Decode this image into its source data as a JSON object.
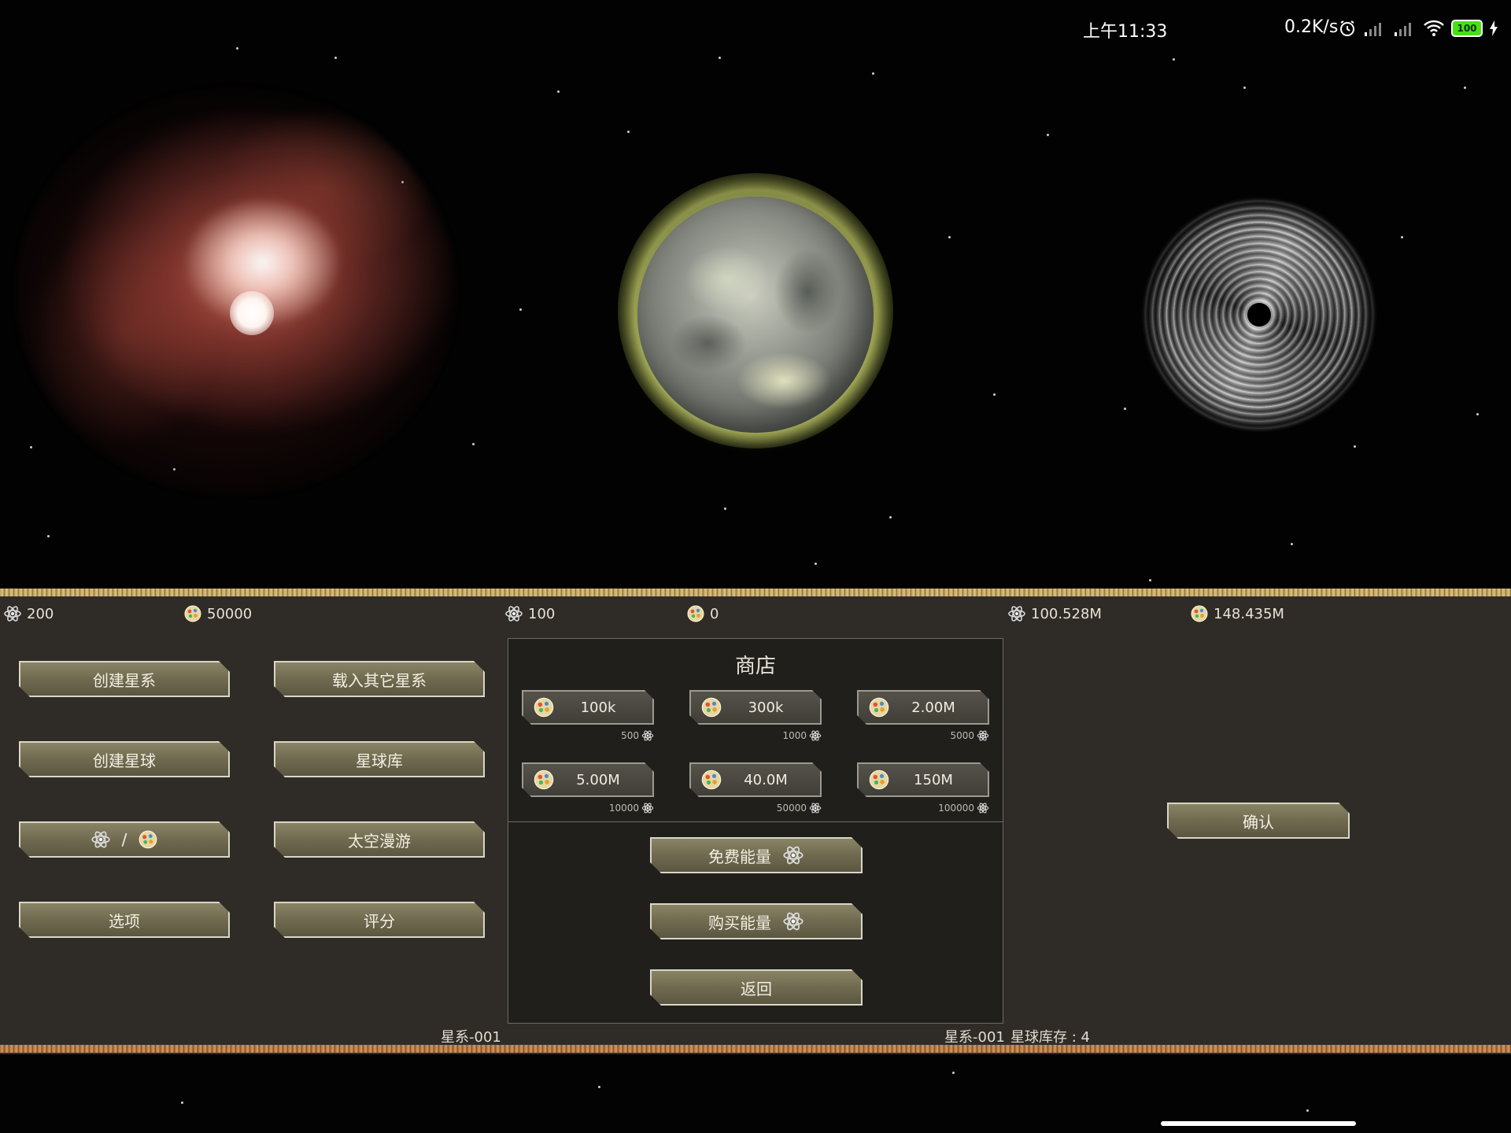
{
  "status_bar": {
    "time": "上午11:33",
    "net_speed": "0.2K/s",
    "battery": "100"
  },
  "resources": {
    "left": {
      "energy": "200",
      "matter": "50000"
    },
    "middle": {
      "energy": "100",
      "matter": "0"
    },
    "right": {
      "energy": "100.528M",
      "matter": "148.435M"
    }
  },
  "menu": {
    "create_galaxy": "创建星系",
    "load_galaxy": "载入其它星系",
    "create_planet": "创建星球",
    "planet_library": "星球库",
    "currency_toggle": "/",
    "space_roam": "太空漫游",
    "options": "选项",
    "rate": "评分"
  },
  "shop": {
    "title": "商店",
    "offers": [
      {
        "amount": "100k",
        "cost": "500"
      },
      {
        "amount": "300k",
        "cost": "1000"
      },
      {
        "amount": "2.00M",
        "cost": "5000"
      },
      {
        "amount": "5.00M",
        "cost": "10000"
      },
      {
        "amount": "40.0M",
        "cost": "50000"
      },
      {
        "amount": "150M",
        "cost": "100000"
      }
    ],
    "free_energy": "免费能量",
    "buy_energy": "购买能量",
    "back": "返回"
  },
  "confirm": "确认",
  "footer": {
    "galaxy_left": "星系-001",
    "galaxy_mid": "星系-001",
    "planet_stock": "星球库存 : 4"
  },
  "colors": {
    "panel_bg": "#2f2c27",
    "shop_bg": "#211f1c",
    "button": "#726c52",
    "rope": "#d9bd82"
  },
  "icons": {
    "energy": "atom-energy-icon",
    "matter": "planet-matter-icon"
  }
}
